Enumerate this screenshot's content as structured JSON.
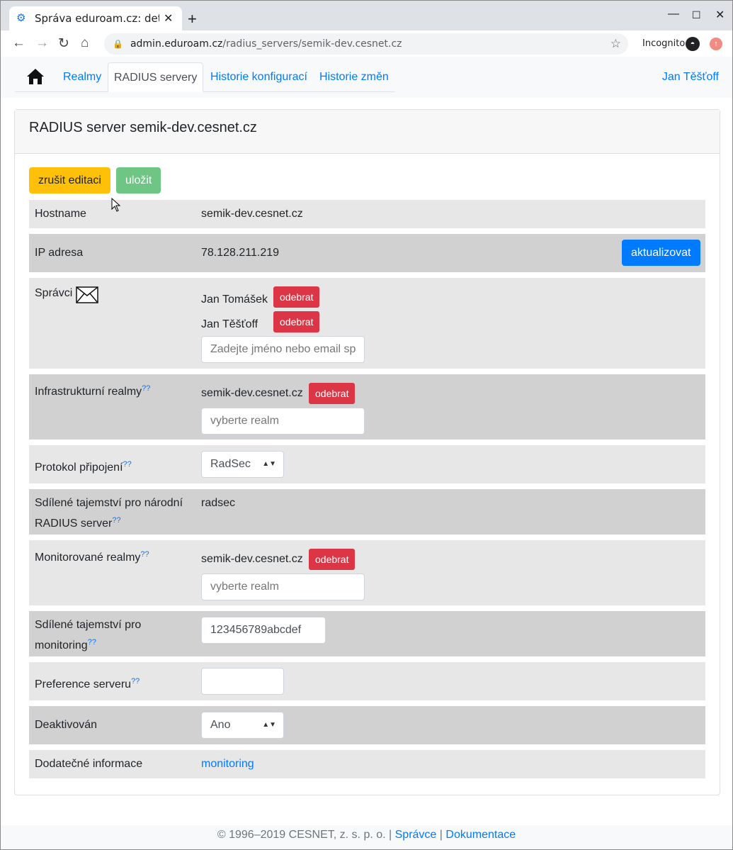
{
  "browser": {
    "tab_title": "Správa eduroam.cz: detail",
    "url_host": "admin.eduroam.cz",
    "url_path": "/radius_servers/semik-dev.cesnet.cz",
    "incognito_label": "Incognito"
  },
  "nav": {
    "items": [
      "Realmy",
      "RADIUS servery",
      "Historie konfigurací",
      "Historie změn"
    ],
    "active": "RADIUS servery",
    "user": "Jan Těšťoff"
  },
  "card": {
    "title": "RADIUS server semik-dev.cesnet.cz",
    "cancel_label": "zrušit editaci",
    "save_label": "uložit"
  },
  "fields": {
    "hostname": {
      "label": "Hostname",
      "value": "semik-dev.cesnet.cz"
    },
    "ip": {
      "label": "IP adresa",
      "value": "78.128.211.219",
      "button": "aktualizovat"
    },
    "admins": {
      "label": "Správci",
      "people": [
        "Jan Tomášek",
        "Jan Těšťoff"
      ],
      "remove_label": "odebrat",
      "placeholder": "Zadejte jméno nebo email sp"
    },
    "infra_realms": {
      "label": "Infrastrukturní realmy",
      "help": "??",
      "value": "semik-dev.cesnet.cz",
      "remove_label": "odebrat",
      "placeholder": "vyberte realm"
    },
    "protocol": {
      "label": "Protokol připojení",
      "help": "??",
      "value": "RadSec"
    },
    "shared_secret": {
      "label_line1": "Sdílené tajemství pro národní",
      "label_line2": "RADIUS server",
      "help": "??",
      "value": "radsec"
    },
    "monitored_realms": {
      "label": "Monitorované realmy",
      "help": "??",
      "value": "semik-dev.cesnet.cz",
      "remove_label": "odebrat",
      "placeholder": "vyberte realm"
    },
    "monitoring_secret": {
      "label_line1": "Sdílené tajemství pro",
      "label_line2": "monitoring",
      "help": "??",
      "value": "123456789abcdef"
    },
    "preference": {
      "label": "Preference serveru",
      "help": "??",
      "value": ""
    },
    "deactivated": {
      "label": "Deaktivován",
      "value": "Ano"
    },
    "additional": {
      "label": "Dodatečné informace",
      "link": "monitoring"
    }
  },
  "footer": {
    "copyright": "© 1996–2019 CESNET, z. s. p. o. |",
    "admins_link": "Správce",
    "separator": "|",
    "docs_link": "Dokumentace"
  }
}
